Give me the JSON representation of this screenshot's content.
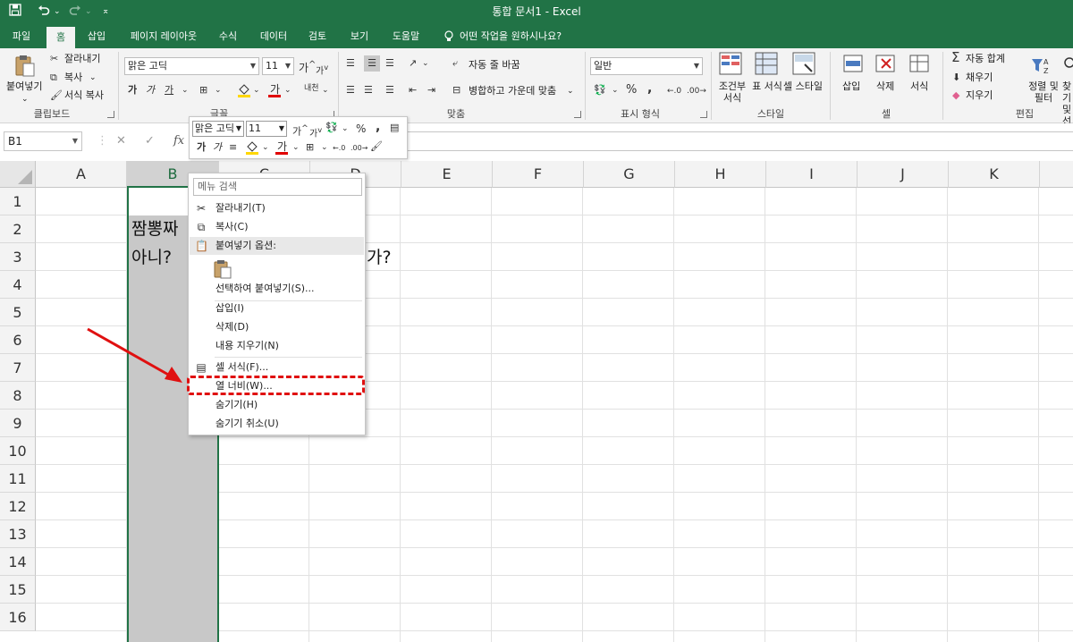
{
  "titlebar": {
    "title": "통합 문서1  -  Excel",
    "save_icon": "save-icon",
    "undo_icon": "undo-icon",
    "redo_icon": "redo-icon",
    "customize_icon": "customize-qat-icon"
  },
  "tabs": [
    "파일",
    "홈",
    "삽입",
    "페이지 레이아웃",
    "수식",
    "데이터",
    "검토",
    "보기",
    "도움말"
  ],
  "tell_me": "어떤 작업을 원하시나요?",
  "ribbon": {
    "clipboard": {
      "paste": "붙여넣기",
      "cut": "잘라내기",
      "copy": "복사",
      "format_painter": "서식 복사",
      "group": "클립보드"
    },
    "font": {
      "name": "맑은 고딕",
      "size": "11",
      "bold": "가",
      "italic": "가",
      "underline": "가",
      "increase": "가",
      "decrease": "가",
      "phonetic": "내천",
      "group": "글꼴"
    },
    "alignment": {
      "wrap": "자동 줄 바꿈",
      "merge": "병합하고 가운데 맞춤",
      "group": "맞춤"
    },
    "number": {
      "format": "일반",
      "percent": "%",
      "comma": ",",
      "group": "표시 형식"
    },
    "styles": {
      "conditional": "조건부 서식",
      "table": "표 서식",
      "cell": "셀 스타일",
      "group": "스타일"
    },
    "cells": {
      "insert": "삽입",
      "delete": "삭제",
      "format": "서식",
      "group": "셀"
    },
    "editing": {
      "autosum": "자동 합계",
      "fill": "채우기",
      "clear": "지우기",
      "sort": "정렬 및 필터",
      "find": "찾기 및 선택",
      "group": "편집"
    }
  },
  "formula_bar": {
    "name_box": "B1",
    "cancel": "✕",
    "enter": "✓",
    "fx": "fx",
    "value": ""
  },
  "grid": {
    "columns": [
      "A",
      "B",
      "C",
      "D",
      "E",
      "F",
      "G",
      "H",
      "I",
      "J",
      "K"
    ],
    "rows": [
      "1",
      "2",
      "3",
      "4",
      "5",
      "6",
      "7",
      "8",
      "9",
      "10",
      "11",
      "12",
      "13",
      "14",
      "15",
      "16"
    ],
    "selected_column": "B",
    "cells": {
      "B2": "짬뽕짜",
      "B3": "아니? ",
      "D3": "가?"
    }
  },
  "mini_toolbar": {
    "font": "맑은 고딕",
    "size": "11",
    "percent": "%",
    "comma": ","
  },
  "context_menu": {
    "search_placeholder": "메뉴 검색",
    "items": {
      "cut": "잘라내기(T)",
      "copy": "복사(C)",
      "paste_options": "붙여넣기 옵션:",
      "paste_special": "선택하여 붙여넣기(S)...",
      "insert": "삽입(I)",
      "delete": "삭제(D)",
      "clear": "내용 지우기(N)",
      "format_cells": "셀 서식(F)...",
      "column_width": "열 너비(W)...",
      "hide": "숨기기(H)",
      "unhide": "숨기기 취소(U)"
    }
  },
  "colors": {
    "excel_green": "#217346",
    "highlight_red": "#e01010",
    "selection_gray": "#c8c8c8"
  }
}
